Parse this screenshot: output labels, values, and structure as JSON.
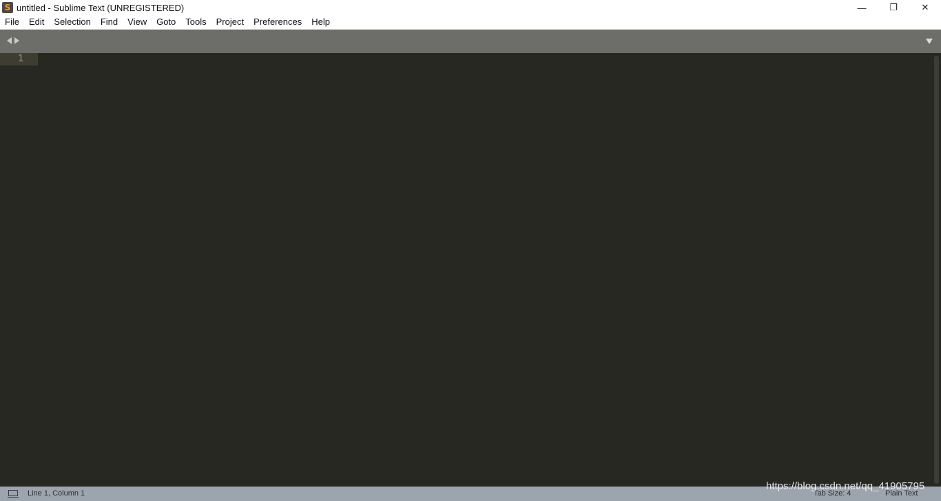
{
  "window": {
    "title": "untitled - Sublime Text (UNREGISTERED)",
    "app_icon": "sublime-s-icon",
    "controls": {
      "minimize": "—",
      "maximize": "❐",
      "close": "✕"
    }
  },
  "menu": {
    "items": [
      "File",
      "Edit",
      "Selection",
      "Find",
      "View",
      "Goto",
      "Tools",
      "Project",
      "Preferences",
      "Help"
    ]
  },
  "editor": {
    "line_numbers": [
      "1"
    ],
    "background": "#272822"
  },
  "status": {
    "position": "Line 1, Column 1",
    "tab_size": "Tab Size: 4",
    "syntax": "Plain Text"
  },
  "watermark": {
    "text": "https://blog.csdn.net/qq_41905795"
  }
}
